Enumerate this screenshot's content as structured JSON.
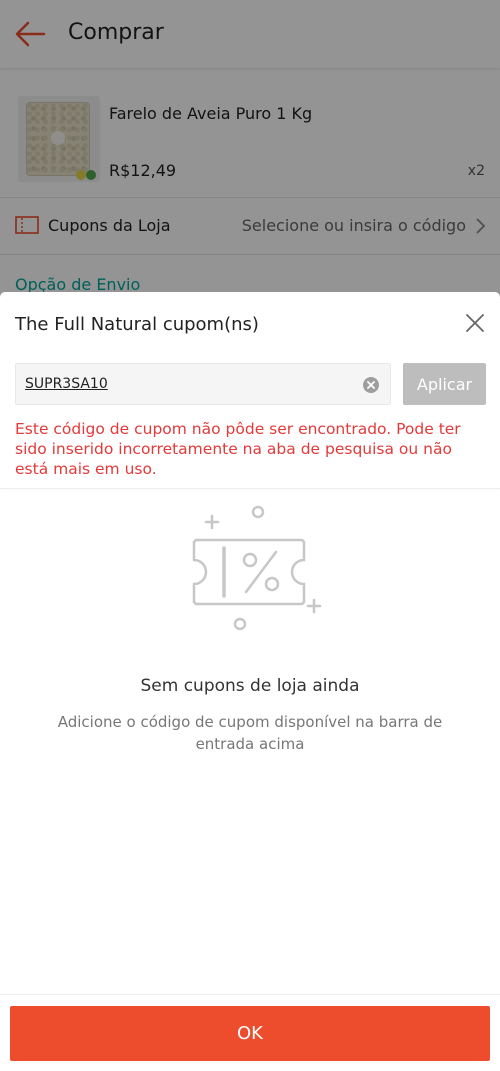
{
  "appbar": {
    "title": "Comprar"
  },
  "product": {
    "name": "Farelo de Aveia Puro 1 Kg",
    "price": "R$12,49",
    "qty": "x2"
  },
  "coupons": {
    "label": "Cupons da Loja",
    "hint": "Selecione ou insira o código"
  },
  "shipping": {
    "label": "Opção de Envio"
  },
  "sheet": {
    "title": "The Full Natural cupom(ns)",
    "input_value": "SUPR3SA10",
    "apply_label": "Aplicar",
    "error": "Este código de cupom não pôde ser encontrado. Pode ter sido inserido incorretamente na aba de pesquisa ou não está mais em uso.",
    "empty_title": "Sem cupons de loja ainda",
    "empty_subtitle": "Adicione o código de cupom disponível na barra de entrada acima",
    "ok_label": "OK"
  },
  "colors": {
    "accent": "#ee4d2d",
    "error": "#e33a3a",
    "teal": "#00a69a",
    "disabled": "#bdbdbd"
  },
  "icons": [
    "back-arrow-icon",
    "ticket-icon",
    "chevron-right-icon",
    "close-icon",
    "clear-input-icon",
    "coupon-percent-icon"
  ]
}
